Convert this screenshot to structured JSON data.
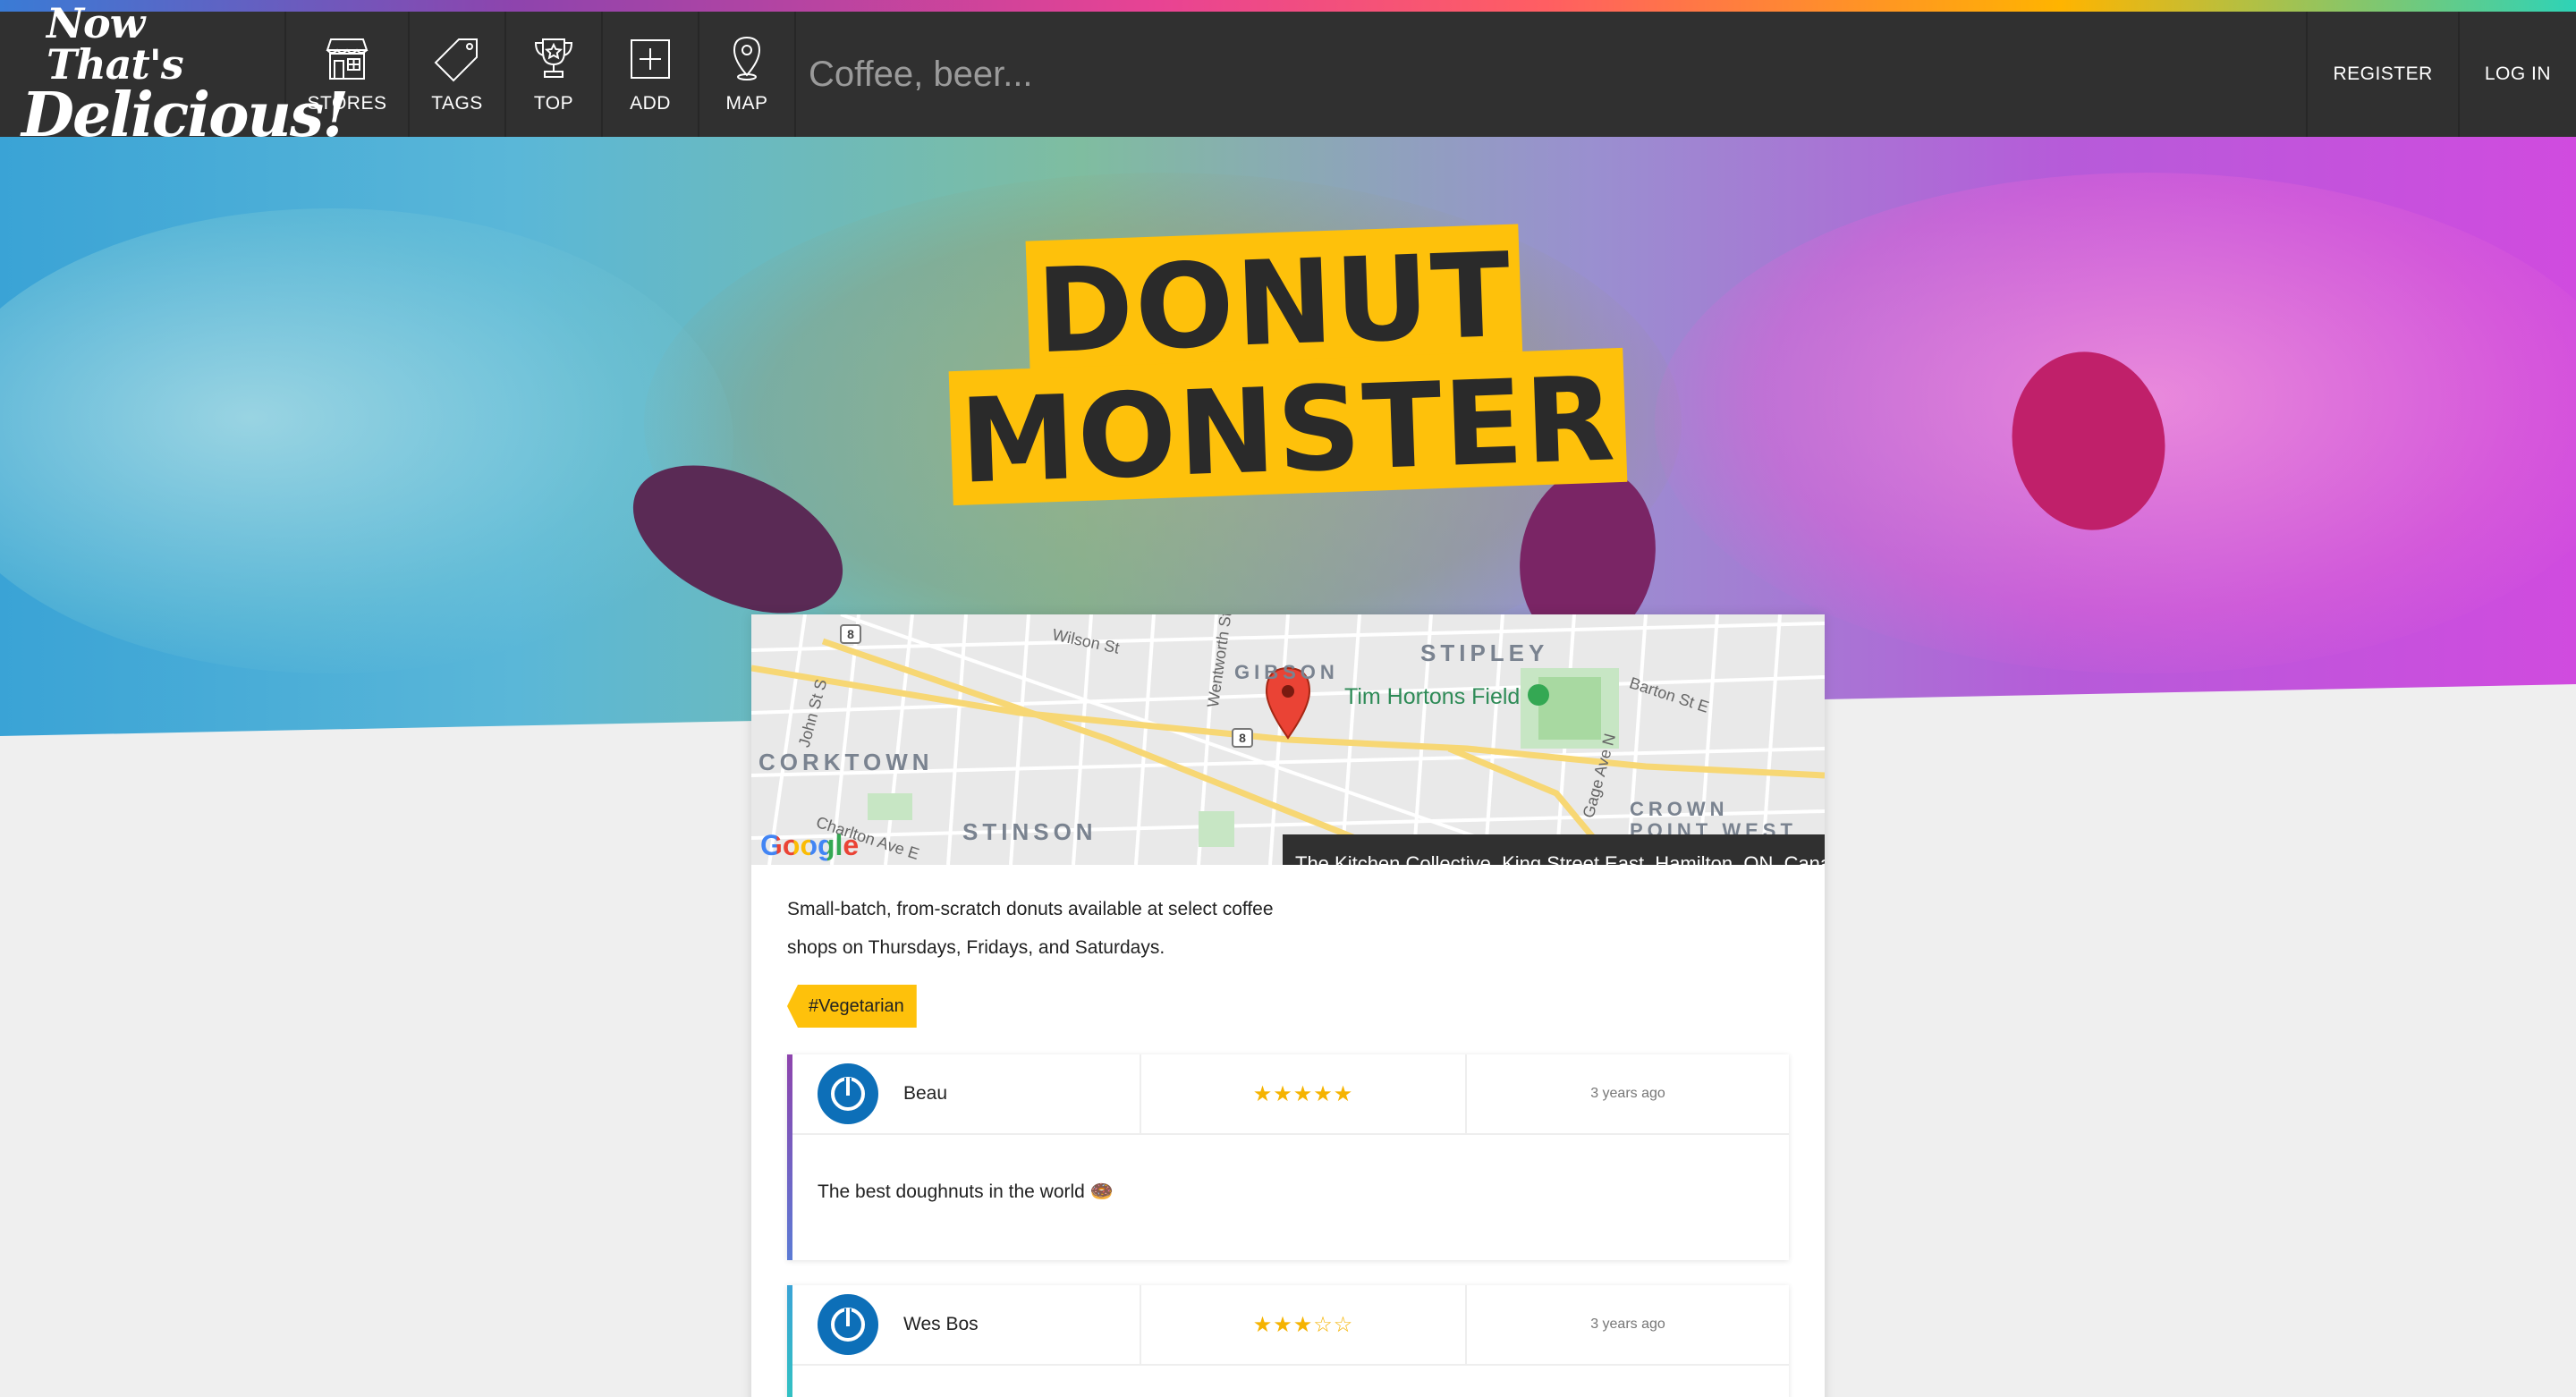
{
  "nav": {
    "logo_line1": "Now That's",
    "logo_line2": "Delicious!",
    "items": [
      {
        "label": "STORES",
        "icon": "store-icon"
      },
      {
        "label": "TAGS",
        "icon": "tag-icon"
      },
      {
        "label": "TOP",
        "icon": "trophy-icon"
      },
      {
        "label": "ADD",
        "icon": "add-icon"
      },
      {
        "label": "MAP",
        "icon": "map-pin-icon"
      }
    ],
    "search_placeholder": "Coffee, beer...",
    "register": "REGISTER",
    "login": "LOG IN"
  },
  "store": {
    "title_line1": "DONUT",
    "title_line2": "MONSTER",
    "description": "Small-batch, from-scratch donuts available at select coffee shops on Thursdays, Fridays, and Saturdays.",
    "address": "The Kitchen Collective, King Street East, Hamilton, ON, Canada",
    "tag": "#Vegetarian"
  },
  "map": {
    "neighborhoods": [
      "CORKTOWN",
      "STINSON",
      "STIPLEY",
      "GIBSON",
      "CROWN POINT WEST"
    ],
    "poi": "Tim Hortons Field",
    "streets": [
      "Wilson St",
      "John St S",
      "Wentworth St",
      "Barton St E",
      "Gage Ave N",
      "Charlton Ave E"
    ],
    "route_badges": [
      "8",
      "8"
    ],
    "brand": "Google"
  },
  "reviews": [
    {
      "author": "Beau",
      "stars": "★★★★★",
      "time": "3 years ago",
      "text": "The best doughnuts in the world 🍩"
    },
    {
      "author": "Wes Bos",
      "stars": "★★★☆☆",
      "time": "3 years ago",
      "text": ""
    }
  ],
  "colors": {
    "accent_yellow": "#fec10b",
    "nav_bg": "#303030",
    "avatar_blue": "#0d6fb8"
  }
}
